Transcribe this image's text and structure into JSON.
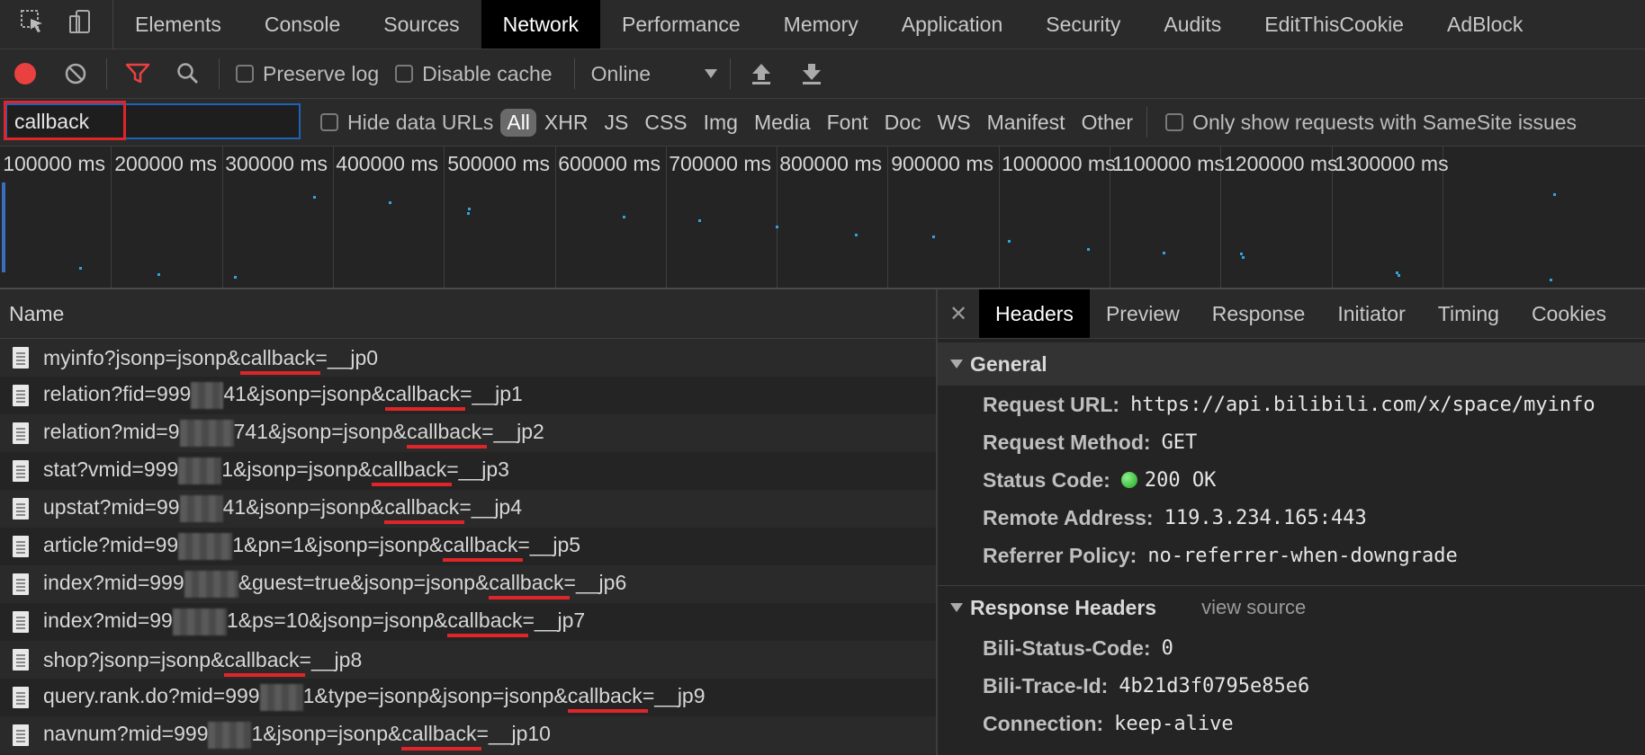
{
  "devtools_tabs": [
    "Elements",
    "Console",
    "Sources",
    "Network",
    "Performance",
    "Memory",
    "Application",
    "Security",
    "Audits",
    "EditThisCookie",
    "AdBlock"
  ],
  "active_tab": "Network",
  "toolbar": {
    "preserve_log": "Preserve log",
    "disable_cache": "Disable cache",
    "throttling": "Online"
  },
  "filter": {
    "value": "callback",
    "hide_data_urls": "Hide data URLs",
    "types": [
      "All",
      "XHR",
      "JS",
      "CSS",
      "Img",
      "Media",
      "Font",
      "Doc",
      "WS",
      "Manifest",
      "Other"
    ],
    "active_type": "All",
    "samesite": "Only show requests with SameSite issues"
  },
  "overview": {
    "ticks": [
      "100000 ms",
      "200000 ms",
      "300000 ms",
      "400000 ms",
      "500000 ms",
      "600000 ms",
      "700000 ms",
      "800000 ms",
      "900000 ms",
      "1000000 ms",
      "1100000 ms",
      "1200000 ms",
      "1300000 ms"
    ]
  },
  "list": {
    "header": "Name",
    "requests": [
      {
        "pre": "myinfo?jsonp=jsonp&",
        "kw": "callback",
        "post": "=__jp0"
      },
      {
        "pre": "relation?fid=999",
        "hidden": "   ",
        "pre2": "41&jsonp=jsonp&",
        "kw": "callback",
        "post": "=__jp1"
      },
      {
        "pre": "relation?mid=9",
        "hidden": "     ",
        "pre2": "741&jsonp=jsonp&",
        "kw": "callback",
        "post": "=__jp2"
      },
      {
        "pre": "stat?vmid=999",
        "hidden": "    ",
        "pre2": "1&jsonp=jsonp&",
        "kw": "callback",
        "post": "=__jp3"
      },
      {
        "pre": "upstat?mid=99",
        "hidden": "    ",
        "pre2": "41&jsonp=jsonp&",
        "kw": "callback",
        "post": "=__jp4"
      },
      {
        "pre": "article?mid=99",
        "hidden": "     ",
        "pre2": "1&pn=1&jsonp=jsonp&",
        "kw": "callback",
        "post": "=__jp5"
      },
      {
        "pre": "index?mid=999",
        "hidden": "     ",
        "pre2": "&guest=true&jsonp=jsonp&",
        "kw": "callback",
        "post": "=__jp6"
      },
      {
        "pre": "index?mid=99",
        "hidden": "     ",
        "pre2": "1&ps=10&jsonp=jsonp&",
        "kw": "callback",
        "post": "=__jp7"
      },
      {
        "pre": "shop?jsonp=jsonp&",
        "kw": "callback",
        "post": "=__jp8"
      },
      {
        "pre": "query.rank.do?mid=999",
        "hidden": "    ",
        "pre2": "1&type=jsonp&jsonp=jsonp&",
        "kw": "callback",
        "post": "=__jp9"
      },
      {
        "pre": "navnum?mid=999",
        "hidden": "    ",
        "pre2": "1&jsonp=jsonp&",
        "kw": "callback",
        "post": "=__jp10"
      }
    ]
  },
  "details": {
    "tabs": [
      "Headers",
      "Preview",
      "Response",
      "Initiator",
      "Timing",
      "Cookies"
    ],
    "active_tab": "Headers",
    "general_title": "General",
    "general": [
      {
        "k": "Request URL:",
        "v": "https://api.bilibili.com/x/space/myinfo"
      },
      {
        "k": "Request Method:",
        "v": "GET"
      },
      {
        "k": "Status Code:",
        "v": "200 OK"
      },
      {
        "k": "Remote Address:",
        "v": "119.3.234.165:443"
      },
      {
        "k": "Referrer Policy:",
        "v": "no-referrer-when-downgrade"
      }
    ],
    "response_headers_title": "Response Headers",
    "view_source": "view source",
    "response_headers": [
      {
        "k": "Bili-Status-Code:",
        "v": "0"
      },
      {
        "k": "Bili-Trace-Id:",
        "v": "4b21d3f0795e85e6"
      },
      {
        "k": "Connection:",
        "v": "keep-alive"
      }
    ]
  },
  "colors": {
    "accent": "#1d64b8",
    "record": "#e94040",
    "highlight": "#e0252a",
    "status_ok": "#1fa51f"
  }
}
